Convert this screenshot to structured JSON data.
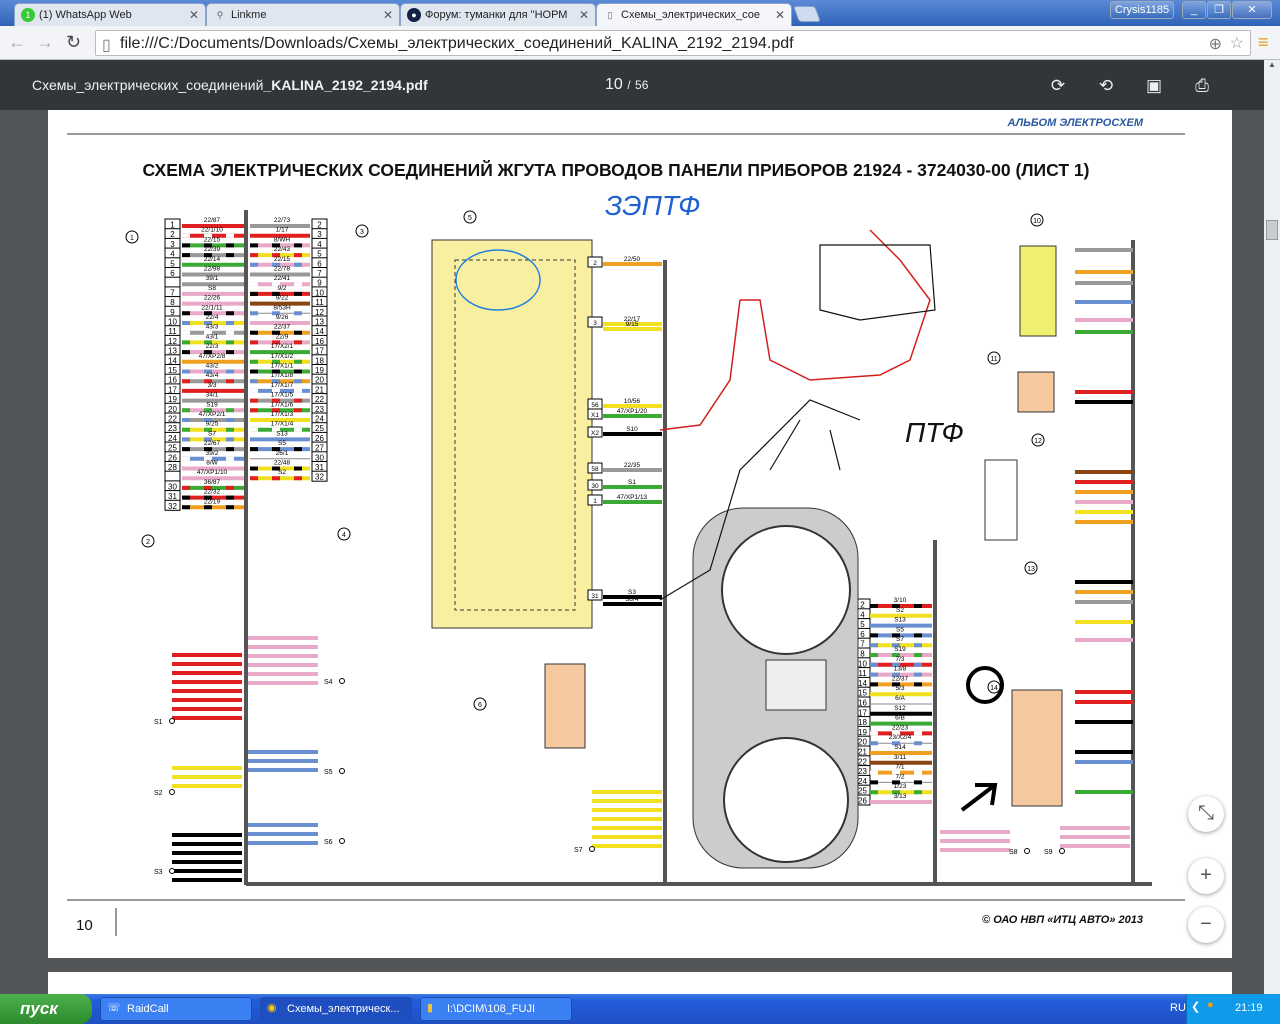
{
  "browser": {
    "tabs": [
      {
        "label": "(1) WhatsApp Web",
        "icon": "whatsapp-icon",
        "badge": "1"
      },
      {
        "label": "Linkme",
        "icon": "paperclip-icon"
      },
      {
        "label": "Форум: туманки для \"НОРМ",
        "icon": "forum-icon"
      },
      {
        "label": "Схемы_электрических_сое",
        "icon": "document-icon",
        "active": true
      }
    ],
    "user": "Crysis1185",
    "url": "file:///C:/Documents/Downloads/Схемы_электрических_соединений_KALINA_2192_2194.pdf"
  },
  "pdf": {
    "title_prefix": "Схемы_электрических_соединений",
    "title_bold": "_KALINA_2192_2194.pdf",
    "page": "10",
    "sep": "/",
    "total": "56"
  },
  "document": {
    "header": "АЛЬБОМ ЭЛЕКТРОСХЕМ",
    "title": "СХЕМА ЭЛЕКТРИЧЕСКИХ СОЕДИНЕНИЙ ЖГУТА ПРОВОДОВ ПАНЕЛИ ПРИБОРОВ 21924 - 3724030-00 (ЛИСТ 1)",
    "footer_page": "10",
    "copyright": "©    ОАО НВП «ИТЦ АВТО»    2013",
    "handwriting": [
      "ЗЭПТФ",
      "ПТФ"
    ],
    "callouts": [
      "1",
      "2",
      "3",
      "4",
      "5",
      "6",
      "10",
      "11",
      "12",
      "13",
      "14"
    ],
    "splices": [
      "S1",
      "S2",
      "S3",
      "S4",
      "S5",
      "S6",
      "S7",
      "S8",
      "S9"
    ],
    "connector1_left": [
      [
        "1",
        "22/87",
        "#e02020",
        ""
      ],
      [
        "2",
        "22/1/10",
        "#e02020",
        "#fff"
      ],
      [
        "3",
        "22/15",
        "#3aaa35",
        "#000"
      ],
      [
        "4",
        "22/39",
        "#999",
        "#000"
      ],
      [
        "5",
        "22/14",
        "#3aaa35",
        ""
      ],
      [
        "6",
        "22/98",
        "#999",
        ""
      ],
      [
        "",
        "39/1",
        "#999",
        ""
      ],
      [
        "7",
        "S8",
        "#e8a8c8",
        ""
      ],
      [
        "8",
        "22/26",
        "#e8a8c8",
        ""
      ],
      [
        "9",
        "22/1/11",
        "#e8a8c8",
        "#000"
      ],
      [
        "10",
        "22/4",
        "#f0e020",
        "#6a8fd0"
      ],
      [
        "11",
        "43/3",
        "#999",
        "#fff"
      ],
      [
        "12",
        "43/1",
        "#f0e020",
        "#3aaa35"
      ],
      [
        "13",
        "22/3",
        "#e8a8c8",
        "#000"
      ],
      [
        "14",
        "47/XP2/8",
        "#f0a020",
        ""
      ],
      [
        "15",
        "43/2",
        "#e8a8c8",
        "#6a8fd0"
      ],
      [
        "16",
        "43/4",
        "#999",
        "#e02020"
      ],
      [
        "17",
        "3/3",
        "#e02020",
        ""
      ],
      [
        "19",
        "34/1",
        "#999",
        ""
      ],
      [
        "20",
        "S19",
        "#e8a8c8",
        "#3aaa35"
      ],
      [
        "22",
        "47/XP2/1",
        "#999",
        "#6a8fd0"
      ],
      [
        "23",
        "9/25",
        "#f0e020",
        "#3aaa35"
      ],
      [
        "24",
        "S7",
        "#f0e020",
        "#6a8fd0"
      ],
      [
        "25",
        "22/67",
        "#999",
        "#000"
      ],
      [
        "26",
        "39/2",
        "#6a8fd0",
        "#fff"
      ],
      [
        "28",
        "8/W",
        "#e8a8c8",
        ""
      ],
      [
        "",
        "47/XP1/10",
        "#e8a8c8",
        ""
      ],
      [
        "30",
        "36/87",
        "#3aaa35",
        "#e02020"
      ],
      [
        "31",
        "22/32",
        "#e02020",
        "#000"
      ],
      [
        "32",
        "22/19",
        "#f0a020",
        "#000"
      ]
    ],
    "connector1_right": [
      [
        "2",
        "22/73",
        "#999",
        ""
      ],
      [
        "3",
        "1/17",
        "#e02020",
        ""
      ],
      [
        "4",
        "8/WH",
        "#e8a8c8",
        "#000"
      ],
      [
        "5",
        "22/43",
        "#f0e020",
        "#e02020"
      ],
      [
        "6",
        "22/15",
        "#e8a8c8",
        "#6a8fd0"
      ],
      [
        "7",
        "22/78",
        "#999",
        ""
      ],
      [
        "9",
        "22/41",
        "#e8a8c8",
        "#fff"
      ],
      [
        "10",
        "9/2",
        "#e02020",
        "#000"
      ],
      [
        "11",
        "9/22",
        "#8b4513",
        ""
      ],
      [
        "12",
        "8/53H",
        "#fff",
        "#6a8fd0"
      ],
      [
        "13",
        "9/26",
        "#e8a8c8",
        ""
      ],
      [
        "14",
        "22/37",
        "#f0a020",
        "#000"
      ],
      [
        "16",
        "22/9",
        "#e8a8c8",
        "#e02020"
      ],
      [
        "17",
        "17/X2/1",
        "#3aaa35",
        ""
      ],
      [
        "18",
        "17/X1/2",
        "#f0e020",
        "#3aaa35"
      ],
      [
        "19",
        "17/X1/1",
        "#3aaa35",
        "#000"
      ],
      [
        "20",
        "17/X1/8",
        "#f0a020",
        "#6a8fd0"
      ],
      [
        "21",
        "17/X1/7",
        "#6a8fd0",
        "#fff"
      ],
      [
        "22",
        "17/X1/5",
        "#999",
        "#e02020"
      ],
      [
        "23",
        "17/X1/6",
        "#3aaa35",
        "#e02020"
      ],
      [
        "24",
        "17/X1/3",
        "#f0e020",
        ""
      ],
      [
        "25",
        "17/X1/4",
        "#3aaa35",
        "#fff"
      ],
      [
        "26",
        "S13",
        "#6a8fd0",
        ""
      ],
      [
        "27",
        "S5",
        "#6a8fd0",
        "#000"
      ],
      [
        "30",
        "26/1",
        "#fff",
        ""
      ],
      [
        "31",
        "22/48",
        "#f0e020",
        "#000"
      ],
      [
        "32",
        "S2",
        "#f0e020",
        "#e02020"
      ]
    ],
    "cluster_connector": [
      [
        "2",
        "3/10",
        "#e02020",
        "#000"
      ],
      [
        "4",
        "S2",
        "#f0e020",
        ""
      ],
      [
        "5",
        "S13",
        "#6a8fd0",
        ""
      ],
      [
        "6",
        "S5",
        "#6a8fd0",
        "#000"
      ],
      [
        "7",
        "S7",
        "#f0e020",
        "#6a8fd0"
      ],
      [
        "8",
        "S19",
        "#e8a8c8",
        "#3aaa35"
      ],
      [
        "10",
        "7/3",
        "#e02020",
        "#6a8fd0"
      ],
      [
        "11",
        "13/8",
        "#e8a8c8",
        "#6a8fd0"
      ],
      [
        "14",
        "22/37",
        "#f0a020",
        "#000"
      ],
      [
        "15",
        "5/3",
        "#f0e020",
        ""
      ],
      [
        "16",
        "6/A",
        "#fff",
        ""
      ],
      [
        "17",
        "S12",
        "#000",
        ""
      ],
      [
        "18",
        "6/B",
        "#3aaa35",
        ""
      ],
      [
        "19",
        "22/23",
        "#e02020",
        "#fff"
      ],
      [
        "20",
        "23/X2/4",
        "#fff",
        "#6a8fd0"
      ],
      [
        "21",
        "S14",
        "#f0a020",
        ""
      ],
      [
        "22",
        "3/11",
        "#8b4513",
        ""
      ],
      [
        "23",
        "7/1",
        "#f0a020",
        "#fff"
      ],
      [
        "24",
        "7/2",
        "#fff",
        "#000"
      ],
      [
        "25",
        "1/23",
        "#f0e020",
        "#3aaa35"
      ],
      [
        "26",
        "3/13",
        "#e8a8c8",
        ""
      ]
    ],
    "relay_wires": [
      [
        "2",
        "22/50"
      ],
      [
        "3",
        "22/17"
      ],
      [
        "",
        "9/15"
      ],
      [
        "56",
        "10/56"
      ],
      [
        "X1",
        "47/XP1/20"
      ],
      [
        "X2",
        "S10"
      ],
      [
        "58",
        "22/35"
      ],
      [
        "30",
        "S1"
      ],
      [
        "1",
        "47/XP1/13"
      ],
      [
        "31",
        "S3"
      ],
      [
        "",
        "38/4"
      ]
    ]
  },
  "taskbar": {
    "start": "пуск",
    "items": [
      {
        "label": "RaidCall"
      },
      {
        "label": "Схемы_электрическ...",
        "active": true
      },
      {
        "label": "I:\\DCIM\\108_FUJI"
      }
    ],
    "lang": "RU",
    "time": "21:19"
  }
}
